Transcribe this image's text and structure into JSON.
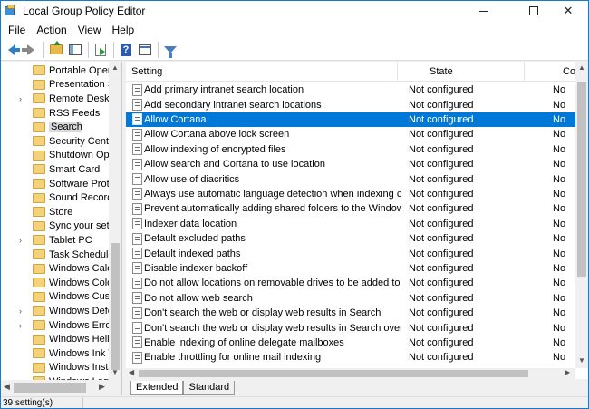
{
  "window": {
    "title": "Local Group Policy Editor"
  },
  "menu": [
    "File",
    "Action",
    "View",
    "Help"
  ],
  "toolbar": {
    "icons": [
      "back-arrow-icon",
      "forward-arrow-icon",
      "up-folder-icon",
      "show-hide-tree-icon",
      "export-list-icon",
      "help-icon",
      "properties-icon",
      "filter-icon"
    ],
    "help_glyph": "?"
  },
  "tree": {
    "items": [
      {
        "label": "Portable Opera",
        "expander": ""
      },
      {
        "label": "Presentation S",
        "expander": ""
      },
      {
        "label": "Remote Deskto",
        "expander": "›"
      },
      {
        "label": "RSS Feeds",
        "expander": ""
      },
      {
        "label": "Search",
        "expander": "",
        "selected": true
      },
      {
        "label": "Security Cente",
        "expander": ""
      },
      {
        "label": "Shutdown Opt",
        "expander": ""
      },
      {
        "label": "Smart Card",
        "expander": ""
      },
      {
        "label": "Software Prote",
        "expander": ""
      },
      {
        "label": "Sound Record",
        "expander": ""
      },
      {
        "label": "Store",
        "expander": ""
      },
      {
        "label": "Sync your sett",
        "expander": ""
      },
      {
        "label": "Tablet PC",
        "expander": "›"
      },
      {
        "label": "Task Schedule",
        "expander": ""
      },
      {
        "label": "Windows Cale",
        "expander": ""
      },
      {
        "label": "Windows Colo",
        "expander": ""
      },
      {
        "label": "Windows Cust",
        "expander": ""
      },
      {
        "label": "Windows Defe",
        "expander": "›"
      },
      {
        "label": "Windows Error",
        "expander": "›"
      },
      {
        "label": "Windows Hello",
        "expander": ""
      },
      {
        "label": "Windows Ink V",
        "expander": ""
      },
      {
        "label": "Windows Insta",
        "expander": ""
      },
      {
        "label": "Windows Logo",
        "expander": ""
      }
    ]
  },
  "list": {
    "columns": {
      "setting": "Setting",
      "state": "State",
      "comment": "Commen"
    },
    "rows": [
      {
        "setting": "Add primary intranet search location",
        "state": "Not configured",
        "comment": "No"
      },
      {
        "setting": "Add secondary intranet search locations",
        "state": "Not configured",
        "comment": "No"
      },
      {
        "setting": "Allow Cortana",
        "state": "Not configured",
        "comment": "No",
        "selected": true
      },
      {
        "setting": "Allow Cortana above lock screen",
        "state": "Not configured",
        "comment": "No"
      },
      {
        "setting": "Allow indexing of encrypted files",
        "state": "Not configured",
        "comment": "No"
      },
      {
        "setting": "Allow search and Cortana to use location",
        "state": "Not configured",
        "comment": "No"
      },
      {
        "setting": "Allow use of diacritics",
        "state": "Not configured",
        "comment": "No"
      },
      {
        "setting": "Always use automatic language detection when indexing co...",
        "state": "Not configured",
        "comment": "No"
      },
      {
        "setting": "Prevent automatically adding shared folders to the Window...",
        "state": "Not configured",
        "comment": "No"
      },
      {
        "setting": "Indexer data location",
        "state": "Not configured",
        "comment": "No"
      },
      {
        "setting": "Default excluded paths",
        "state": "Not configured",
        "comment": "No"
      },
      {
        "setting": "Default indexed paths",
        "state": "Not configured",
        "comment": "No"
      },
      {
        "setting": "Disable indexer backoff",
        "state": "Not configured",
        "comment": "No"
      },
      {
        "setting": "Do not allow locations on removable drives to be added to li...",
        "state": "Not configured",
        "comment": "No"
      },
      {
        "setting": "Do not allow web search",
        "state": "Not configured",
        "comment": "No"
      },
      {
        "setting": "Don't search the web or display web results in Search",
        "state": "Not configured",
        "comment": "No"
      },
      {
        "setting": "Don't search the web or display web results in Search over ...",
        "state": "Not configured",
        "comment": "No"
      },
      {
        "setting": "Enable indexing of online delegate mailboxes",
        "state": "Not configured",
        "comment": "No"
      },
      {
        "setting": "Enable throttling for online mail indexing",
        "state": "Not configured",
        "comment": "No"
      }
    ]
  },
  "tabs": [
    "Extended",
    "Standard"
  ],
  "status": {
    "text": "39 setting(s)"
  }
}
